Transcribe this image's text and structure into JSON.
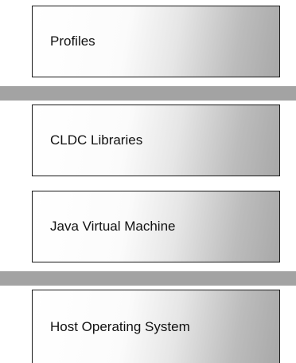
{
  "layers": [
    {
      "label": "Profiles"
    },
    {
      "label": "CLDC Libraries"
    },
    {
      "label": "Java Virtual Machine"
    },
    {
      "label": "Host Operating System"
    }
  ]
}
